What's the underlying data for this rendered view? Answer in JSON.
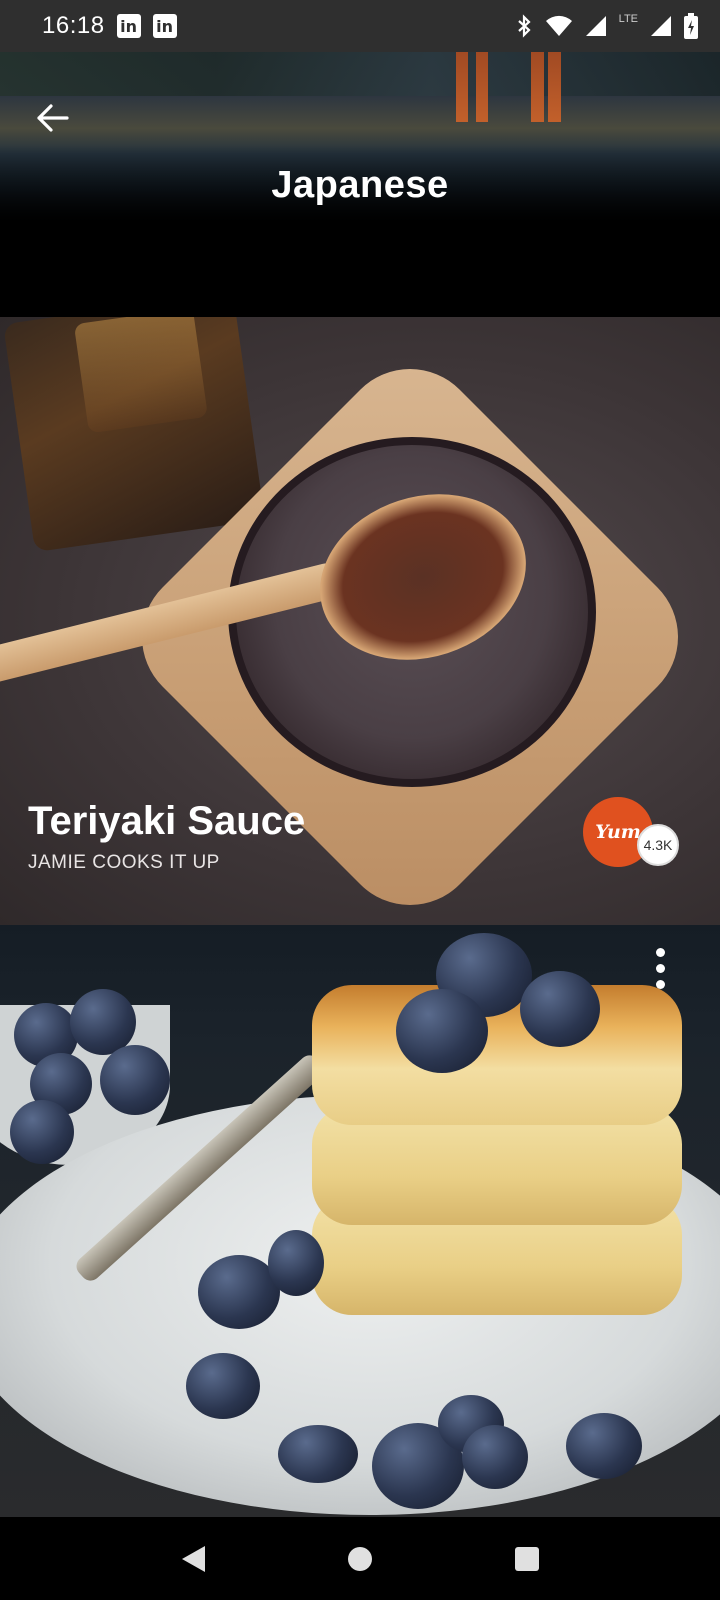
{
  "status_bar": {
    "time": "16:18",
    "notification_icons": [
      "linkedin-icon",
      "linkedin-icon"
    ],
    "notification_glyph": "in",
    "network_label": "LTE",
    "system_icons": [
      "bluetooth-icon",
      "wifi-icon",
      "signal-icon",
      "signal-icon",
      "battery-icon"
    ]
  },
  "header": {
    "title": "Japanese",
    "back_icon": "arrow-left-icon"
  },
  "cards": [
    {
      "title": "Teriyaki Sauce",
      "source": "JAMIE COOKS IT UP",
      "yum_label": "Yum",
      "yum_count": "4.3K"
    },
    {
      "more_icon": "more-vert-icon"
    }
  ],
  "nav_bar": {
    "icons": [
      "back-triangle-icon",
      "home-circle-icon",
      "recents-square-icon"
    ]
  },
  "colors": {
    "yum_accent": "#e0511f",
    "status_bar": "#2f2f2f",
    "nav_bar": "#000000"
  }
}
